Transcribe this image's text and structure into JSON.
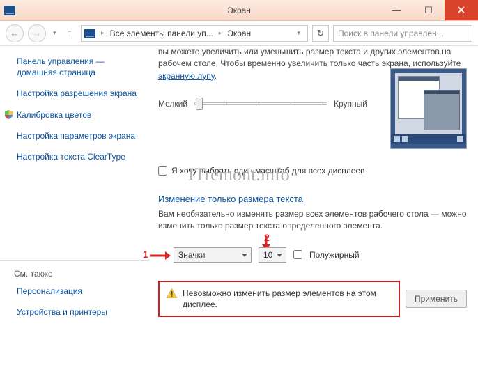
{
  "title": "Экран",
  "nav": {
    "crumb1": "Все элементы панели уп...",
    "crumb2": "Экран",
    "search_placeholder": "Поиск в панели управлен..."
  },
  "sidebar": {
    "home": "Панель управления — домашняя страница",
    "items": [
      "Настройка разрешения экрана",
      "Калибровка цветов",
      "Настройка параметров экрана",
      "Настройка текста ClearType"
    ],
    "see_also_title": "См. также",
    "see_also": [
      "Персонализация",
      "Устройства и принтеры"
    ]
  },
  "content": {
    "intro_pre": "вы можете увеличить или уменьшить размер текста и других элементов на рабочем столе. Чтобы временно увеличить только часть экрана, используйте ",
    "intro_link": "экранную лупу",
    "slider_small": "Мелкий",
    "slider_large": "Крупный",
    "checkbox_label": "Я хочу выбрать один масштаб для всех дисплеев",
    "section_title": "Изменение только размера текста",
    "section_desc": "Вам необязательно изменять размер всех элементов рабочего стола — можно изменить только размер текста определенного элемента.",
    "element_select": "Значки",
    "size_select": "10",
    "bold_label": "Полужирный",
    "warning_text": "Невозможно изменить размер элементов на этом дисплее.",
    "apply_label": "Применить",
    "annotation1": "1",
    "annotation2": "2"
  },
  "watermark": "ITremont.info"
}
